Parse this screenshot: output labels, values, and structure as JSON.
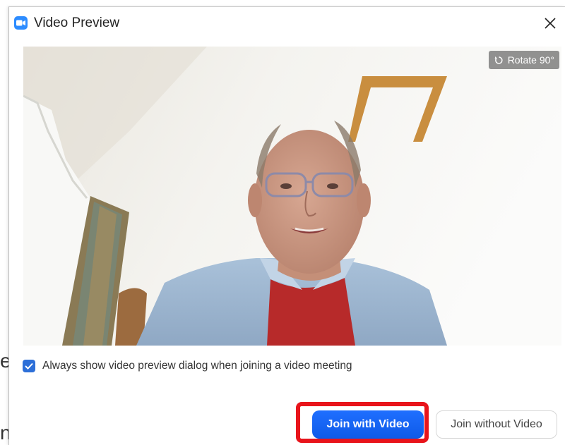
{
  "background": {
    "char_top": "e",
    "char_bottom": "n"
  },
  "dialog": {
    "title": "Video Preview",
    "app_icon": "zoom-camera-icon",
    "close_icon": "close-icon"
  },
  "video": {
    "rotate_label": "Rotate 90°",
    "rotate_icon": "rotate-icon"
  },
  "preferences": {
    "checkbox_label": "Always show video preview dialog when joining a video meeting",
    "checkbox_checked": true
  },
  "actions": {
    "join_with_video": "Join with Video",
    "join_without_video": "Join without Video",
    "highlight_color": "#e8141b",
    "primary_color": "#0e5ae8"
  }
}
